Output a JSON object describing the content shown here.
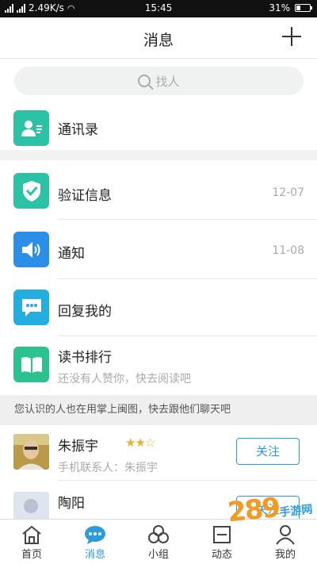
{
  "status_bar": {
    "network_speed": "2.49K/s",
    "time": "15:45",
    "battery": "31%",
    "battery_level": 0.31
  },
  "header": {
    "title": "消息"
  },
  "search": {
    "placeholder": "找人"
  },
  "contacts": {
    "label": "通讯录",
    "icon": "contacts-icon",
    "color": "#2bc2a6"
  },
  "messages": [
    {
      "label": "验证信息",
      "date": "12-07",
      "icon": "shield-check-icon",
      "color": "#2bc2a6"
    },
    {
      "label": "通知",
      "date": "11-08",
      "icon": "speaker-icon",
      "color": "#2b8fe8"
    },
    {
      "label": "回复我的",
      "date": "",
      "icon": "chat-bubble-icon",
      "color": "#23aee0"
    },
    {
      "label": "读书排行",
      "sub": "还没有人赞你，快去阅读吧",
      "icon": "book-icon",
      "color": "#2bc290"
    }
  ],
  "notice": {
    "text": "您认识的人也在用掌上闽图，快去跟他们聊天吧"
  },
  "people": [
    {
      "name": "朱振宇",
      "desc": "手机联系人：朱振宇",
      "stars": 2,
      "stars_total": 3,
      "button": "关注"
    },
    {
      "name": "陶阳",
      "button": "关注"
    }
  ],
  "tabs": [
    {
      "label": "首页",
      "icon": "home-icon"
    },
    {
      "label": "消息",
      "icon": "message-icon",
      "active": true
    },
    {
      "label": "小组",
      "icon": "group-icon"
    },
    {
      "label": "动态",
      "icon": "feed-icon"
    },
    {
      "label": "我的",
      "icon": "profile-icon"
    }
  ],
  "watermark": {
    "text": "289",
    "sub": "手游网"
  }
}
